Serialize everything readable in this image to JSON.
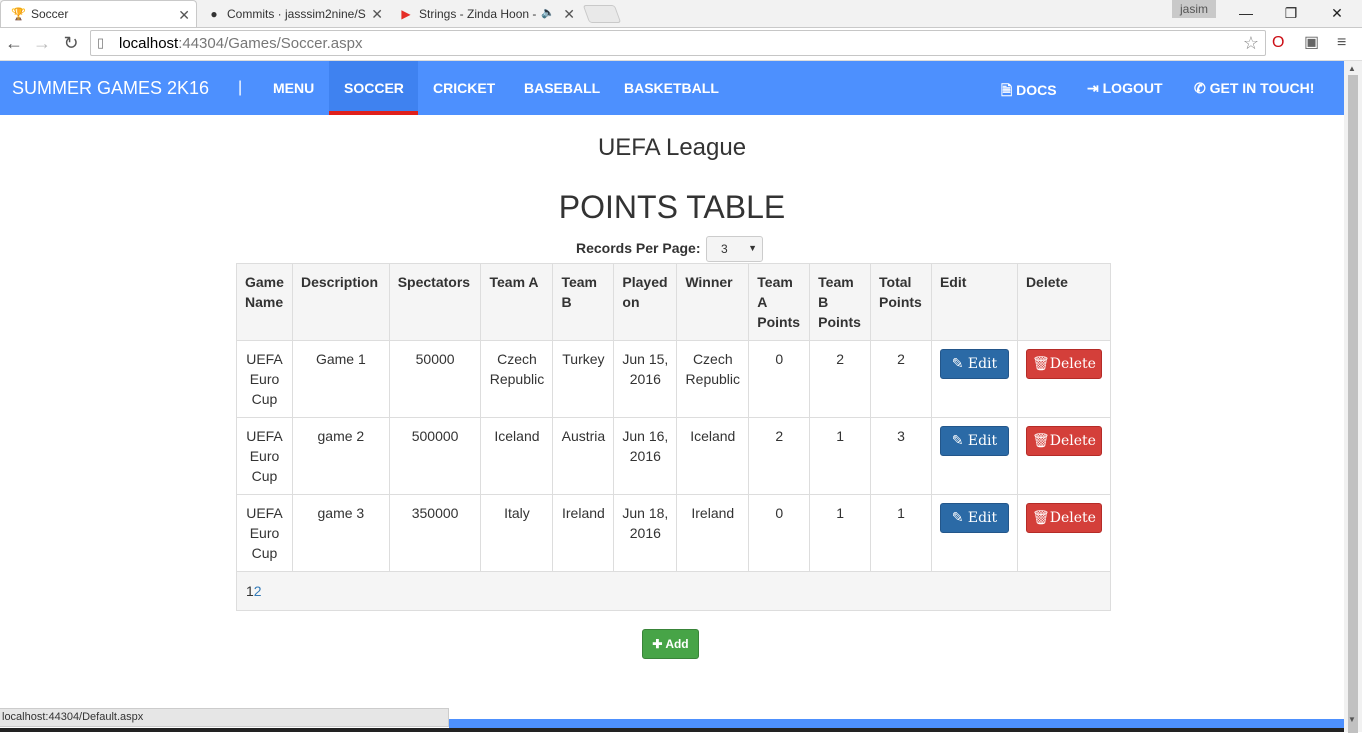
{
  "browser": {
    "tabs": [
      {
        "title": "Soccer",
        "favicon": "soccer-favicon"
      },
      {
        "title": "Commits · jasssim2nine/S",
        "favicon": "github-icon"
      },
      {
        "title": "Strings - Zinda Hoon -",
        "favicon": "youtube-icon"
      }
    ],
    "user": "jasim",
    "url_host": "localhost",
    "url_path": ":44304/Games/Soccer.aspx",
    "status_text": "localhost:44304/Default.aspx"
  },
  "navbar": {
    "brand": "SUMMER GAMES 2K16",
    "separator": "|",
    "links": [
      "MENU",
      "SOCCER",
      "CRICKET",
      "BASEBALL",
      "BASKETBALL"
    ],
    "active": "SOCCER",
    "right_links": [
      "DOCS",
      "LOGOUT",
      "GET IN TOUCH!"
    ],
    "accent_color": "#4d90fe",
    "active_underline_color": "#e0201b"
  },
  "page": {
    "league": "UEFA League",
    "title": "POINTS TABLE",
    "records_label": "Records Per Page:",
    "records_value": "3"
  },
  "table": {
    "headers": [
      "Game Name",
      "Description",
      "Spectators",
      "Team A",
      "Team B",
      "Played on",
      "Winner",
      "Team A Points",
      "Team B Points",
      "Total Points",
      "Edit",
      "Delete"
    ],
    "rows": [
      [
        "UEFA Euro Cup",
        "Game 1",
        "50000",
        "Czech Republic",
        "Turkey",
        "Jun 15, 2016",
        "Czech Republic",
        "0",
        "2",
        "2"
      ],
      [
        "UEFA Euro Cup",
        "game 2",
        "500000",
        "Iceland",
        "Austria",
        "Jun 16, 2016",
        "Iceland",
        "2",
        "1",
        "3"
      ],
      [
        "UEFA Euro Cup",
        "game 3",
        "350000",
        "Italy",
        "Ireland",
        "Jun 18, 2016",
        "Ireland",
        "0",
        "1",
        "1"
      ]
    ],
    "edit_label": "Edit",
    "delete_label": "Delete",
    "pager": {
      "current": "1",
      "other": "2"
    }
  },
  "add_label": "Add"
}
